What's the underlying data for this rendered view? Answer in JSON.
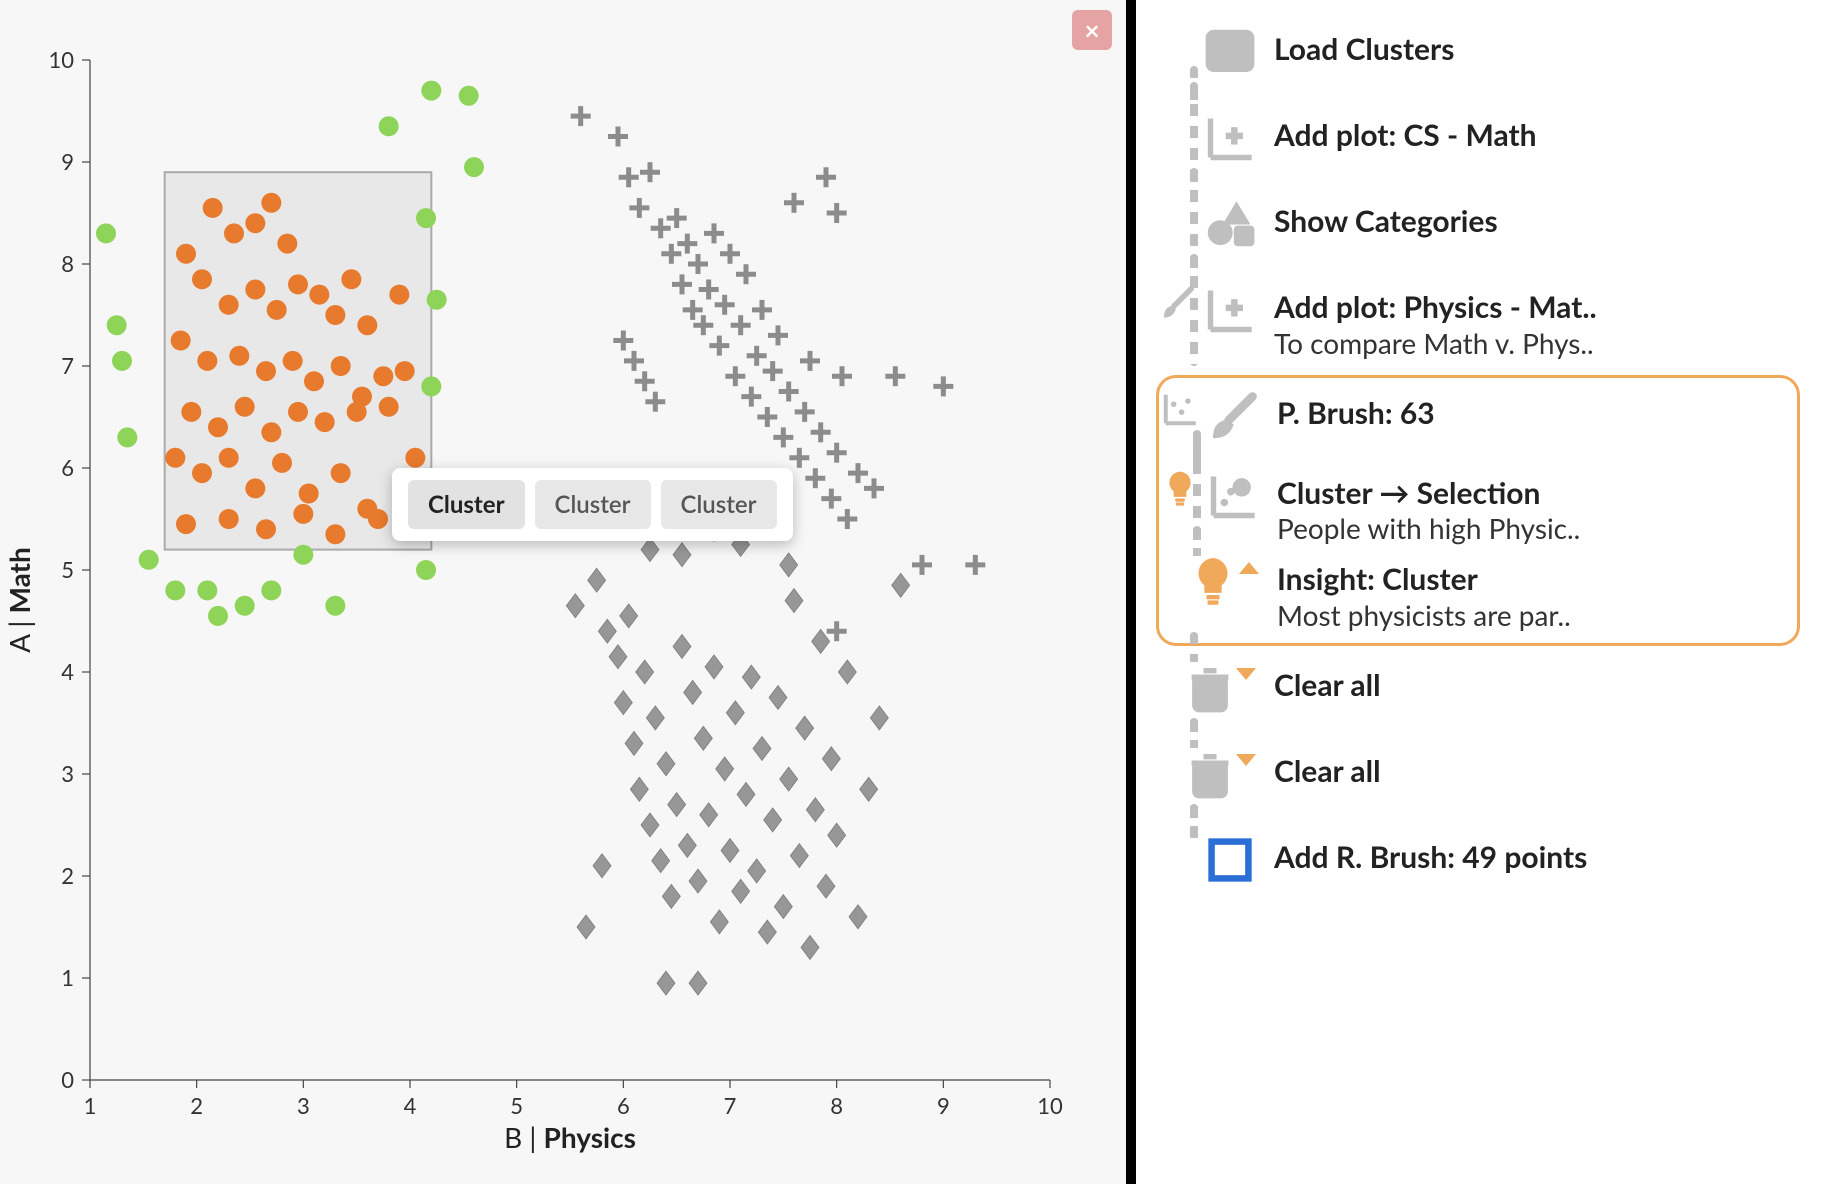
{
  "close_label": "×",
  "tooltip": {
    "opt1": "Cluster",
    "opt2": "Cluster",
    "opt3": "Cluster"
  },
  "axes": {
    "ylabel_a": "A | ",
    "ylabel_b": "Math",
    "xlabel_a": "B | ",
    "xlabel_b": "Physics"
  },
  "prov": [
    {
      "title": "Load Clusters",
      "sub": ""
    },
    {
      "title": "Add plot: CS - Math",
      "sub": ""
    },
    {
      "title": "Show Categories",
      "sub": ""
    },
    {
      "title": "Add plot: Physics - Mat..",
      "sub": "To compare Math v. Phys.."
    },
    {
      "title": "P. Brush: 63",
      "sub": ""
    },
    {
      "title": "Cluster → Selection",
      "sub": "People with high Physic.."
    },
    {
      "title": "Insight: Cluster",
      "sub": "Most physicists are par.."
    },
    {
      "title": "Clear all",
      "sub": ""
    },
    {
      "title": "Clear all",
      "sub": ""
    },
    {
      "title": "Add R. Brush: 49 points",
      "sub": ""
    }
  ],
  "chart_data": {
    "type": "scatter",
    "title": "",
    "xlabel": "B | Physics",
    "ylabel": "A | Math",
    "xlim": [
      1,
      10
    ],
    "ylim": [
      0,
      10
    ],
    "xticks": [
      1,
      2,
      3,
      4,
      5,
      6,
      7,
      8,
      9,
      10
    ],
    "yticks": [
      0,
      1,
      2,
      3,
      4,
      5,
      6,
      7,
      8,
      9,
      10
    ],
    "brush": {
      "x0": 1.7,
      "x1": 4.2,
      "y0": 5.2,
      "y1": 8.9
    },
    "series": [
      {
        "name": "selected-orange",
        "marker": "circle",
        "color": "#e87a2d",
        "points": [
          [
            1.9,
            8.1
          ],
          [
            2.15,
            8.55
          ],
          [
            2.35,
            8.3
          ],
          [
            2.55,
            8.4
          ],
          [
            2.7,
            8.6
          ],
          [
            2.85,
            8.2
          ],
          [
            2.05,
            7.85
          ],
          [
            2.3,
            7.6
          ],
          [
            2.55,
            7.75
          ],
          [
            2.75,
            7.55
          ],
          [
            2.95,
            7.8
          ],
          [
            3.15,
            7.7
          ],
          [
            3.3,
            7.5
          ],
          [
            3.45,
            7.85
          ],
          [
            3.6,
            7.4
          ],
          [
            1.85,
            7.25
          ],
          [
            2.1,
            7.05
          ],
          [
            2.4,
            7.1
          ],
          [
            2.65,
            6.95
          ],
          [
            2.9,
            7.05
          ],
          [
            3.1,
            6.85
          ],
          [
            3.35,
            7.0
          ],
          [
            3.55,
            6.7
          ],
          [
            3.75,
            6.9
          ],
          [
            1.95,
            6.55
          ],
          [
            2.2,
            6.4
          ],
          [
            2.45,
            6.6
          ],
          [
            2.7,
            6.35
          ],
          [
            2.95,
            6.55
          ],
          [
            3.2,
            6.45
          ],
          [
            3.5,
            6.55
          ],
          [
            3.8,
            6.6
          ],
          [
            1.8,
            6.1
          ],
          [
            2.05,
            5.95
          ],
          [
            2.3,
            6.1
          ],
          [
            2.55,
            5.8
          ],
          [
            2.8,
            6.05
          ],
          [
            3.05,
            5.75
          ],
          [
            3.35,
            5.95
          ],
          [
            3.6,
            5.6
          ],
          [
            1.9,
            5.45
          ],
          [
            2.3,
            5.5
          ],
          [
            2.65,
            5.4
          ],
          [
            3.0,
            5.55
          ],
          [
            3.3,
            5.35
          ],
          [
            3.7,
            5.5
          ],
          [
            4.0,
            5.7
          ],
          [
            4.05,
            6.1
          ],
          [
            3.95,
            6.95
          ],
          [
            3.9,
            7.7
          ]
        ]
      },
      {
        "name": "outside-green",
        "marker": "circle",
        "color": "#8ed459",
        "points": [
          [
            1.15,
            8.3
          ],
          [
            1.25,
            7.4
          ],
          [
            1.3,
            7.05
          ],
          [
            1.35,
            6.3
          ],
          [
            1.55,
            5.1
          ],
          [
            1.8,
            4.8
          ],
          [
            2.1,
            4.8
          ],
          [
            2.2,
            4.55
          ],
          [
            2.45,
            4.65
          ],
          [
            2.7,
            4.8
          ],
          [
            3.0,
            5.15
          ],
          [
            3.3,
            4.65
          ],
          [
            4.15,
            5.0
          ],
          [
            4.15,
            8.45
          ],
          [
            4.2,
            6.8
          ],
          [
            4.25,
            7.65
          ],
          [
            3.8,
            9.35
          ],
          [
            4.2,
            9.7
          ],
          [
            4.55,
            9.65
          ],
          [
            4.6,
            8.95
          ]
        ]
      },
      {
        "name": "plus-gray",
        "marker": "plus",
        "color": "#7a7a7a",
        "points": [
          [
            5.6,
            9.45
          ],
          [
            5.95,
            9.25
          ],
          [
            6.05,
            8.85
          ],
          [
            6.15,
            8.55
          ],
          [
            6.25,
            8.9
          ],
          [
            6.35,
            8.35
          ],
          [
            6.45,
            8.1
          ],
          [
            6.5,
            8.45
          ],
          [
            6.55,
            7.8
          ],
          [
            6.6,
            8.2
          ],
          [
            6.65,
            7.55
          ],
          [
            6.7,
            8.0
          ],
          [
            6.75,
            7.4
          ],
          [
            6.8,
            7.75
          ],
          [
            6.85,
            8.3
          ],
          [
            6.9,
            7.2
          ],
          [
            6.95,
            7.6
          ],
          [
            7.0,
            8.1
          ],
          [
            7.05,
            6.9
          ],
          [
            7.1,
            7.4
          ],
          [
            7.15,
            7.9
          ],
          [
            7.2,
            6.7
          ],
          [
            7.25,
            7.1
          ],
          [
            7.3,
            7.55
          ],
          [
            7.35,
            6.5
          ],
          [
            7.4,
            6.95
          ],
          [
            7.45,
            7.3
          ],
          [
            7.5,
            6.3
          ],
          [
            7.55,
            6.75
          ],
          [
            7.6,
            8.6
          ],
          [
            7.65,
            6.1
          ],
          [
            7.7,
            6.55
          ],
          [
            7.75,
            7.05
          ],
          [
            7.8,
            5.9
          ],
          [
            7.85,
            6.35
          ],
          [
            7.9,
            8.85
          ],
          [
            7.95,
            5.7
          ],
          [
            8.0,
            6.15
          ],
          [
            8.05,
            6.9
          ],
          [
            8.1,
            5.5
          ],
          [
            8.2,
            5.95
          ],
          [
            8.35,
            5.8
          ],
          [
            8.55,
            6.9
          ],
          [
            8.8,
            5.05
          ],
          [
            9.0,
            6.8
          ],
          [
            9.3,
            5.05
          ],
          [
            8.0,
            8.5
          ],
          [
            6.0,
            7.25
          ],
          [
            6.1,
            7.05
          ],
          [
            6.2,
            6.85
          ],
          [
            6.3,
            6.65
          ],
          [
            8.0,
            4.4
          ]
        ]
      },
      {
        "name": "diamond-gray",
        "marker": "diamond",
        "color": "#777777",
        "points": [
          [
            5.55,
            4.65
          ],
          [
            5.75,
            4.9
          ],
          [
            5.85,
            4.4
          ],
          [
            5.95,
            4.15
          ],
          [
            6.0,
            3.7
          ],
          [
            6.05,
            4.55
          ],
          [
            6.1,
            3.3
          ],
          [
            6.15,
            2.85
          ],
          [
            6.2,
            4.0
          ],
          [
            6.25,
            2.5
          ],
          [
            6.3,
            3.55
          ],
          [
            6.35,
            2.15
          ],
          [
            6.4,
            3.1
          ],
          [
            6.45,
            1.8
          ],
          [
            6.5,
            2.7
          ],
          [
            6.55,
            4.25
          ],
          [
            6.6,
            2.3
          ],
          [
            6.65,
            3.8
          ],
          [
            6.7,
            1.95
          ],
          [
            6.75,
            3.35
          ],
          [
            6.8,
            2.6
          ],
          [
            6.85,
            4.05
          ],
          [
            6.9,
            1.55
          ],
          [
            6.95,
            3.05
          ],
          [
            7.0,
            2.25
          ],
          [
            7.05,
            3.6
          ],
          [
            7.1,
            1.85
          ],
          [
            7.15,
            2.8
          ],
          [
            7.2,
            3.95
          ],
          [
            7.25,
            2.05
          ],
          [
            7.3,
            3.25
          ],
          [
            7.35,
            1.45
          ],
          [
            7.4,
            2.55
          ],
          [
            7.45,
            3.75
          ],
          [
            7.5,
            1.7
          ],
          [
            7.55,
            2.95
          ],
          [
            7.6,
            4.7
          ],
          [
            7.65,
            2.2
          ],
          [
            7.7,
            3.45
          ],
          [
            7.75,
            1.3
          ],
          [
            7.8,
            2.65
          ],
          [
            7.85,
            4.3
          ],
          [
            7.9,
            1.9
          ],
          [
            7.95,
            3.15
          ],
          [
            8.0,
            2.4
          ],
          [
            8.1,
            4.0
          ],
          [
            8.2,
            1.6
          ],
          [
            8.3,
            2.85
          ],
          [
            8.4,
            3.55
          ],
          [
            8.6,
            4.85
          ],
          [
            6.25,
            5.2
          ],
          [
            6.55,
            5.15
          ],
          [
            6.85,
            5.4
          ],
          [
            7.1,
            5.25
          ],
          [
            7.35,
            5.55
          ],
          [
            7.55,
            5.05
          ],
          [
            6.4,
            0.95
          ],
          [
            6.7,
            0.95
          ],
          [
            5.65,
            1.5
          ],
          [
            5.8,
            2.1
          ]
        ]
      }
    ]
  }
}
